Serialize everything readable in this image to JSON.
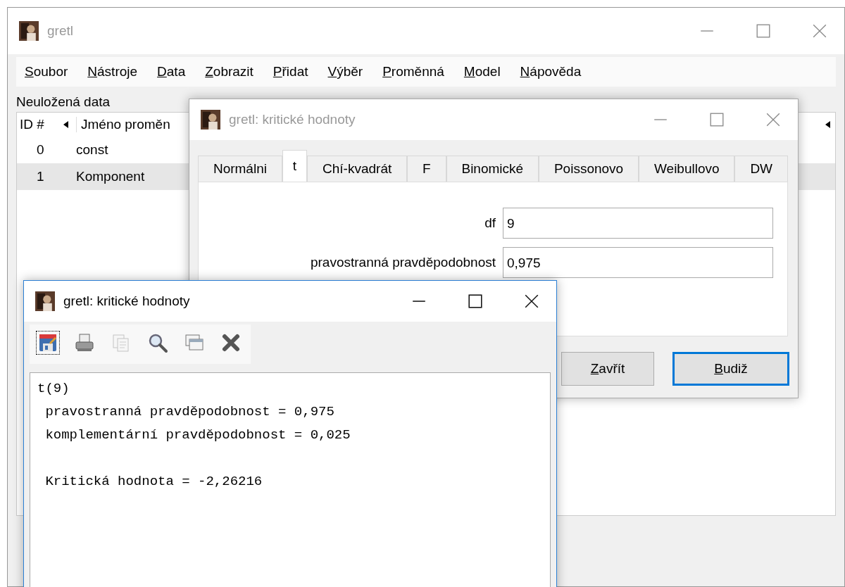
{
  "main_window": {
    "title": "gretl",
    "active": false,
    "menu": [
      "Soubor",
      "Nástroje",
      "Data",
      "Zobrazit",
      "Přidat",
      "Výběr",
      "Proměnná",
      "Model",
      "Nápověda"
    ],
    "dataset_label": "Neuložená data",
    "table": {
      "columns": [
        "ID #",
        "Jméno proměn"
      ],
      "rows": [
        {
          "id": "0",
          "name": "const",
          "selected": false
        },
        {
          "id": "1",
          "name": "Komponent",
          "selected": true
        }
      ]
    }
  },
  "dialog": {
    "title": "gretl: kritické hodnoty",
    "active": false,
    "tabs": [
      {
        "label": "Normálni",
        "selected": false
      },
      {
        "label": "t",
        "selected": true
      },
      {
        "label": "Chí-kvadrát",
        "selected": false
      },
      {
        "label": "F",
        "selected": false
      },
      {
        "label": "Binomické",
        "selected": false
      },
      {
        "label": "Poissonovo",
        "selected": false
      },
      {
        "label": "Weibullovo",
        "selected": false
      },
      {
        "label": "DW",
        "selected": false
      }
    ],
    "fields": [
      {
        "label": "df",
        "value": "9"
      },
      {
        "label": "pravostranná pravděpodobnost",
        "value": "0,975"
      }
    ],
    "buttons": [
      {
        "label": "Zavřít",
        "focused": false
      },
      {
        "label": "Budiž",
        "focused": true
      }
    ]
  },
  "output_window": {
    "title": "gretl: kritické hodnoty",
    "active": true,
    "toolbar": [
      {
        "kind": "save",
        "disabled": false
      },
      {
        "kind": "print",
        "disabled": false
      },
      {
        "kind": "copy",
        "disabled": true
      },
      {
        "kind": "search",
        "disabled": false
      },
      {
        "kind": "windows",
        "disabled": false
      },
      {
        "kind": "close",
        "disabled": false
      }
    ],
    "text": "t(9)\n pravostranná pravděpodobnost = 0,975\n komplementární pravděpodobnost = 0,025\n\n Kritická hodnota = -2,26216"
  }
}
